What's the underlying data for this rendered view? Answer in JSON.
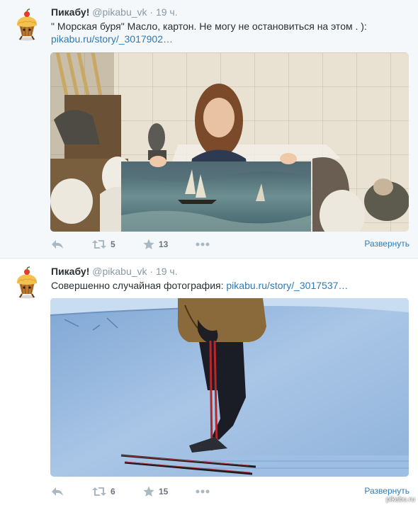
{
  "tweets": [
    {
      "author_name": "Пикабу!",
      "author_handle": "@pikabu_vk",
      "time": "· 19 ч.",
      "text": "\" Морская буря\"   Масло, картон. Не могу не остановиться на этом . ):",
      "link": "pikabu.ru/story/_3017902…",
      "retweets": "5",
      "favorites": "13",
      "expand_label": "Развернуть"
    },
    {
      "author_name": "Пикабу!",
      "author_handle": "@pikabu_vk",
      "time": "· 19 ч.",
      "text": "Совершенно случайная фотография:",
      "link": "pikabu.ru/story/_3017537…",
      "retweets": "6",
      "favorites": "15",
      "expand_label": "Развернуть"
    }
  ],
  "watermark": "pikabu.ru",
  "icons": [
    "pikabu-cupcake-avatar",
    "reply-icon",
    "retweet-icon",
    "favorite-star-icon",
    "more-icon"
  ],
  "colors": {
    "link": "#2b7bb9",
    "meta": "#8899a6",
    "action": "#aab8c2",
    "panel": "#f5f8fa"
  }
}
